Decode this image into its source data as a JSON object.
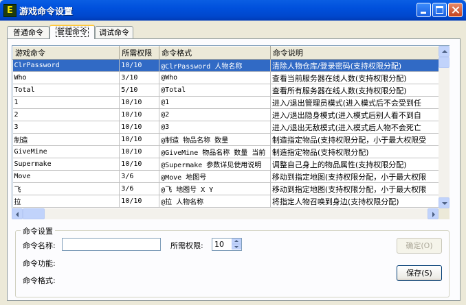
{
  "window": {
    "title": "游戏命令设置"
  },
  "tabs": [
    {
      "label": "普通命令",
      "active": false
    },
    {
      "label": "管理命令",
      "active": true
    },
    {
      "label": "调试命令",
      "active": false
    }
  ],
  "table": {
    "columns": [
      "游戏命令",
      "所需权限",
      "命令格式",
      "命令说明"
    ],
    "selected_row": 0,
    "rows": [
      [
        "ClrPassword",
        "10/10",
        "@ClrPassword 人物名称",
        "清除人物仓库/登录密码(支持权限分配)"
      ],
      [
        "Who",
        "3/10",
        "@Who",
        "查看当前服务器在线人数(支持权限分配)"
      ],
      [
        "Total",
        "5/10",
        "@Total",
        "查看所有服务器在线人数(支持权限分配)"
      ],
      [
        "1",
        "10/10",
        "@1",
        "进入/退出管理员模式(进入模式后不会受到任"
      ],
      [
        "2",
        "10/10",
        "@2",
        "进入/退出隐身模式(进入模式后别人看不到自"
      ],
      [
        "3",
        "10/10",
        "@3",
        "进入/退出无敌模式(进入模式后人物不会死亡"
      ],
      [
        "制造",
        "10/10",
        "@制造 物品名称 数量",
        "制造指定物品(支持权限分配，小于最大权限受"
      ],
      [
        "GiveMine",
        "10/10",
        "@GiveMine 物品名称 数量 当前",
        "制造指定物品(支持权限分配)"
      ],
      [
        "Supermake",
        "10/10",
        "@Supermake 参数详见使用说明",
        "调整自己身上的物品属性(支持权限分配)"
      ],
      [
        "Move",
        "3/6",
        "@Move 地图号",
        "移动到指定地图(支持权限分配，小于最大权限"
      ],
      [
        "飞",
        "3/6",
        "@飞 地图号 X Y",
        "移动到指定地图(支持权限分配，小于最大权限"
      ],
      [
        "拉",
        "10/10",
        "@拉 人物名称",
        "将指定人物召唤到身边(支持权限分配)"
      ]
    ]
  },
  "group": {
    "legend": "命令设置",
    "name_label": "命令名称:",
    "name_value": "",
    "permission_label": "所需权限:",
    "permission_value": "10",
    "function_label": "命令功能:",
    "format_label": "命令格式:",
    "confirm_label": "确定(O)",
    "save_label": "保存(S)"
  },
  "colors": {
    "titlebar": "#0054E3",
    "selection": "#316AC5",
    "window_bg": "#ECE9D8",
    "active_tab_accent": "#FFC83C"
  },
  "icons": {
    "app": "app-e-icon",
    "minimize": "minimize-icon",
    "maximize": "maximize-icon",
    "close": "close-icon"
  }
}
